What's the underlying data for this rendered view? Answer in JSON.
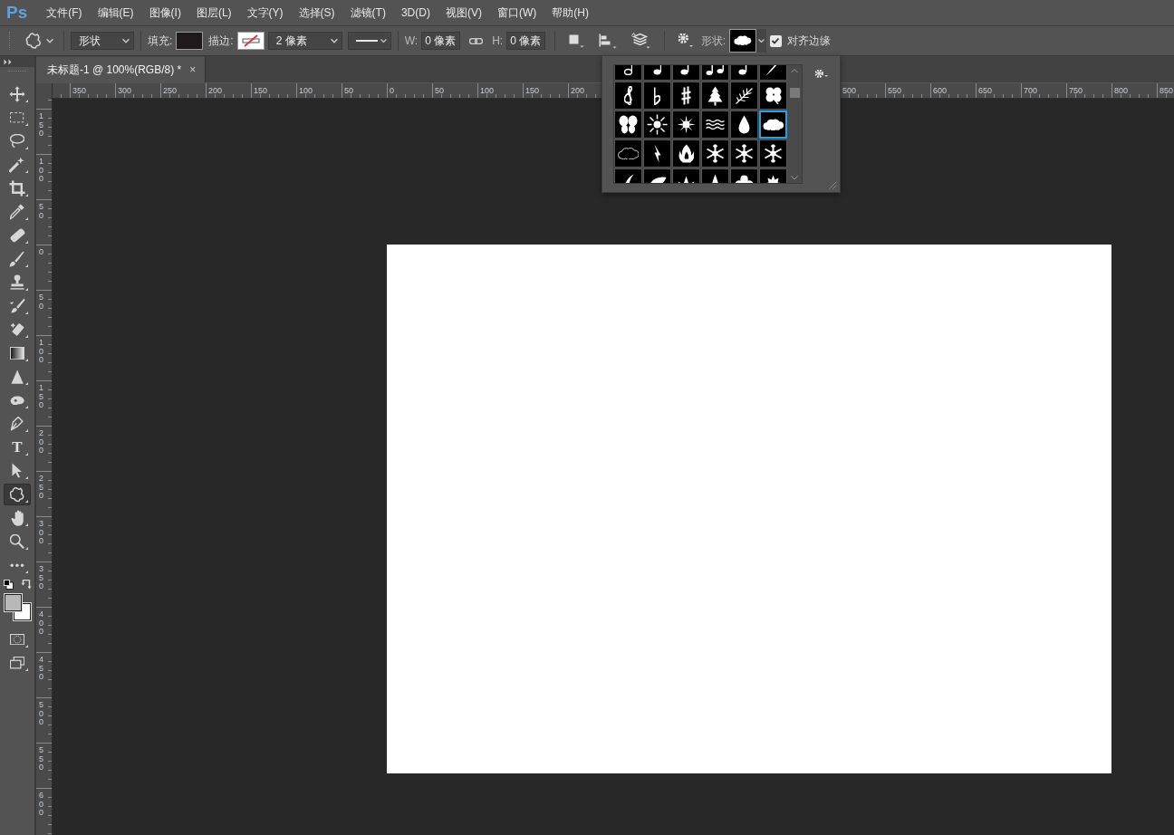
{
  "app": {
    "logo": "Ps"
  },
  "menu": [
    "文件(F)",
    "编辑(E)",
    "图像(I)",
    "图层(L)",
    "文字(Y)",
    "选择(S)",
    "滤镜(T)",
    "3D(D)",
    "视图(V)",
    "窗口(W)",
    "帮助(H)"
  ],
  "options_bar": {
    "mode": "形状",
    "fill_label": "填充:",
    "stroke_label": "描边:",
    "stroke_width": "2 像素",
    "width_label": "W:",
    "width_value": "0 像素",
    "height_label": "H:",
    "height_value": "0 像素",
    "shape_label": "形状:",
    "align_edges": {
      "label": "对齐边缘",
      "checked": true
    }
  },
  "tabs": [
    {
      "title": "未标题-1 @ 100%(RGB/8) *",
      "close": "×",
      "selected": true
    }
  ],
  "horizontal_ruler": {
    "segments": [
      {
        "labels": [
          "350",
          "300",
          "250",
          "200",
          "150",
          "100",
          "50",
          "0",
          "50",
          "100",
          "150",
          "200"
        ]
      },
      {
        "labels": [
          "500",
          "550",
          "600",
          "650",
          "700",
          "750",
          "800",
          "850"
        ]
      }
    ]
  },
  "vertical_ruler": {
    "labels": [
      "150",
      "100",
      "50",
      "0",
      "50",
      "100",
      "150",
      "200",
      "250",
      "300",
      "350",
      "400",
      "450",
      "500",
      "550",
      "600"
    ]
  },
  "tools": [
    {
      "kind": "move",
      "selected": false
    },
    {
      "kind": "marquee",
      "selected": false
    },
    {
      "kind": "lasso",
      "selected": false
    },
    {
      "kind": "wand",
      "selected": false
    },
    {
      "kind": "crop",
      "selected": false
    },
    {
      "kind": "eyedropper",
      "selected": false
    },
    {
      "kind": "healing",
      "selected": false
    },
    {
      "kind": "brush",
      "selected": false
    },
    {
      "kind": "stamp",
      "selected": false
    },
    {
      "kind": "history-brush",
      "selected": false
    },
    {
      "kind": "eraser",
      "selected": false
    },
    {
      "kind": "gradient",
      "selected": false
    },
    {
      "kind": "blur",
      "selected": false
    },
    {
      "kind": "dodge",
      "selected": false
    },
    {
      "kind": "pen",
      "selected": false
    },
    {
      "kind": "type",
      "label": "T",
      "selected": false
    },
    {
      "kind": "path-select",
      "selected": false
    },
    {
      "kind": "custom-shape",
      "selected": true
    },
    {
      "kind": "hand",
      "selected": false
    },
    {
      "kind": "zoom",
      "selected": false
    },
    {
      "kind": "more",
      "selected": false
    }
  ],
  "shape_picker": {
    "shapes": [
      {
        "kind": "half-note",
        "selected": false
      },
      {
        "kind": "quarter-note",
        "selected": false
      },
      {
        "kind": "eighth-note",
        "selected": false
      },
      {
        "kind": "beamed-notes",
        "selected": false
      },
      {
        "kind": "eighth-note",
        "selected": false
      },
      {
        "kind": "shard",
        "selected": false
      },
      {
        "kind": "treble-clef",
        "selected": false
      },
      {
        "kind": "flat",
        "selected": false
      },
      {
        "kind": "sharp",
        "selected": false
      },
      {
        "kind": "tree",
        "selected": false
      },
      {
        "kind": "fern",
        "selected": false
      },
      {
        "kind": "clover",
        "selected": false
      },
      {
        "kind": "butterfly",
        "selected": false
      },
      {
        "kind": "sunburst",
        "selected": false
      },
      {
        "kind": "sun",
        "selected": false
      },
      {
        "kind": "waves",
        "selected": false
      },
      {
        "kind": "drop",
        "selected": false
      },
      {
        "kind": "cloud",
        "selected": true
      },
      {
        "kind": "cloud-outline",
        "selected": false
      },
      {
        "kind": "lightning",
        "selected": false
      },
      {
        "kind": "fire",
        "selected": false
      },
      {
        "kind": "snowflake",
        "selected": false
      },
      {
        "kind": "snowflake",
        "selected": false
      },
      {
        "kind": "snowflake",
        "selected": false
      },
      {
        "kind": "moon",
        "selected": false
      },
      {
        "kind": "leaf",
        "selected": false
      },
      {
        "kind": "lotus",
        "selected": false
      },
      {
        "kind": "spike",
        "selected": false
      },
      {
        "kind": "flower",
        "selected": false
      },
      {
        "kind": "maple",
        "selected": false
      }
    ]
  }
}
